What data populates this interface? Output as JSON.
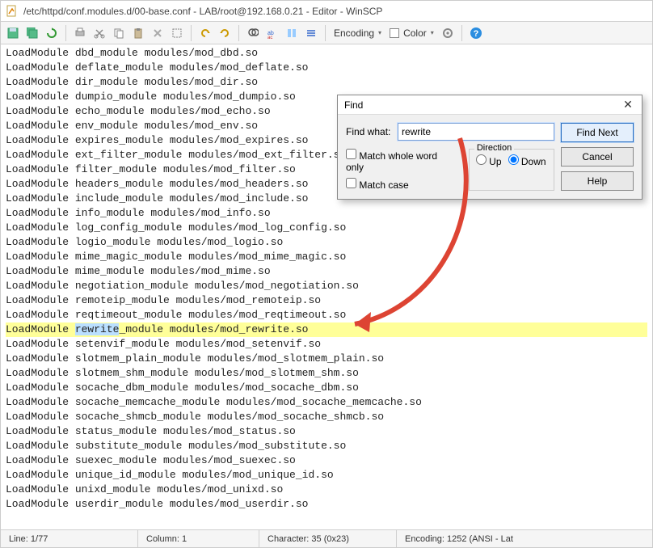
{
  "window": {
    "title": "/etc/httpd/conf.modules.d/00-base.conf - LAB/root@192.168.0.21 - Editor - WinSCP"
  },
  "toolbar": {
    "encoding_label": "Encoding",
    "color_label": "Color"
  },
  "editor_lines": [
    {
      "text": "LoadModule dbd_module modules/mod_dbd.so"
    },
    {
      "text": "LoadModule deflate_module modules/mod_deflate.so"
    },
    {
      "text": "LoadModule dir_module modules/mod_dir.so"
    },
    {
      "text": "LoadModule dumpio_module modules/mod_dumpio.so"
    },
    {
      "text": "LoadModule echo_module modules/mod_echo.so"
    },
    {
      "text": "LoadModule env_module modules/mod_env.so"
    },
    {
      "text": "LoadModule expires_module modules/mod_expires.so"
    },
    {
      "text": "LoadModule ext_filter_module modules/mod_ext_filter.so"
    },
    {
      "text": "LoadModule filter_module modules/mod_filter.so"
    },
    {
      "text": "LoadModule headers_module modules/mod_headers.so"
    },
    {
      "text": "LoadModule include_module modules/mod_include.so"
    },
    {
      "text": "LoadModule info_module modules/mod_info.so"
    },
    {
      "text": "LoadModule log_config_module modules/mod_log_config.so"
    },
    {
      "text": "LoadModule logio_module modules/mod_logio.so"
    },
    {
      "text": "LoadModule mime_magic_module modules/mod_mime_magic.so"
    },
    {
      "text": "LoadModule mime_module modules/mod_mime.so"
    },
    {
      "text": "LoadModule negotiation_module modules/mod_negotiation.so"
    },
    {
      "text": "LoadModule remoteip_module modules/mod_remoteip.so"
    },
    {
      "text": "LoadModule reqtimeout_module modules/mod_reqtimeout.so"
    },
    {
      "text": "LoadModule rewrite_module modules/mod_rewrite.so",
      "highlight": true,
      "selection_prefix": "LoadModule ",
      "selection_sel": "rewrite",
      "selection_suffix": "_module modules/mod_rewrite.so"
    },
    {
      "text": "LoadModule setenvif_module modules/mod_setenvif.so"
    },
    {
      "text": "LoadModule slotmem_plain_module modules/mod_slotmem_plain.so"
    },
    {
      "text": "LoadModule slotmem_shm_module modules/mod_slotmem_shm.so"
    },
    {
      "text": "LoadModule socache_dbm_module modules/mod_socache_dbm.so"
    },
    {
      "text": "LoadModule socache_memcache_module modules/mod_socache_memcache.so"
    },
    {
      "text": "LoadModule socache_shmcb_module modules/mod_socache_shmcb.so"
    },
    {
      "text": "LoadModule status_module modules/mod_status.so"
    },
    {
      "text": "LoadModule substitute_module modules/mod_substitute.so"
    },
    {
      "text": "LoadModule suexec_module modules/mod_suexec.so"
    },
    {
      "text": "LoadModule unique_id_module modules/mod_unique_id.so"
    },
    {
      "text": "LoadModule unixd_module modules/mod_unixd.so"
    },
    {
      "text": "LoadModule userdir_module modules/mod_userdir.so"
    }
  ],
  "status": {
    "line": "Line: 1/77",
    "column": "Column: 1",
    "character": "Character: 35 (0x23)",
    "encoding": "Encoding: 1252 (ANSI - Lat"
  },
  "find": {
    "title": "Find",
    "find_what_label": "Find what:",
    "find_what_value": "rewrite",
    "match_word": "Match whole word only",
    "match_case": "Match case",
    "direction_label": "Direction",
    "up_label": "Up",
    "down_label": "Down",
    "find_next": "Find Next",
    "cancel": "Cancel",
    "help": "Help"
  }
}
